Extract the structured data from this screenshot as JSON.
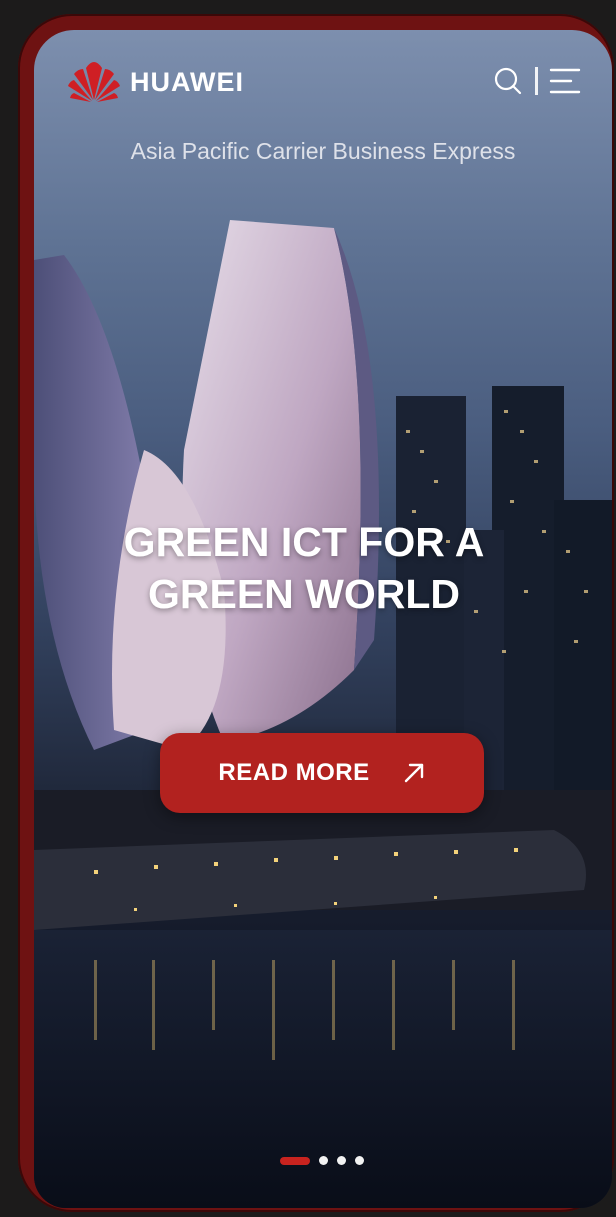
{
  "header": {
    "brand_name": "HUAWEI",
    "logo_icon": "huawei-petal-logo",
    "search_icon": "search-icon",
    "menu_icon": "hamburger-menu-icon"
  },
  "hero": {
    "subtitle": "Asia Pacific Carrier Business Express",
    "headline_line1": "GREEN ICT FOR A",
    "headline_line2": "GREEN WORLD",
    "cta_label": "READ MORE",
    "cta_icon": "arrow-up-right-icon"
  },
  "carousel": {
    "slide_count": 4,
    "active_index": 0
  },
  "colors": {
    "brand_red": "#c8231f",
    "cta_red": "#b2221f",
    "frame": "#6e1212"
  }
}
